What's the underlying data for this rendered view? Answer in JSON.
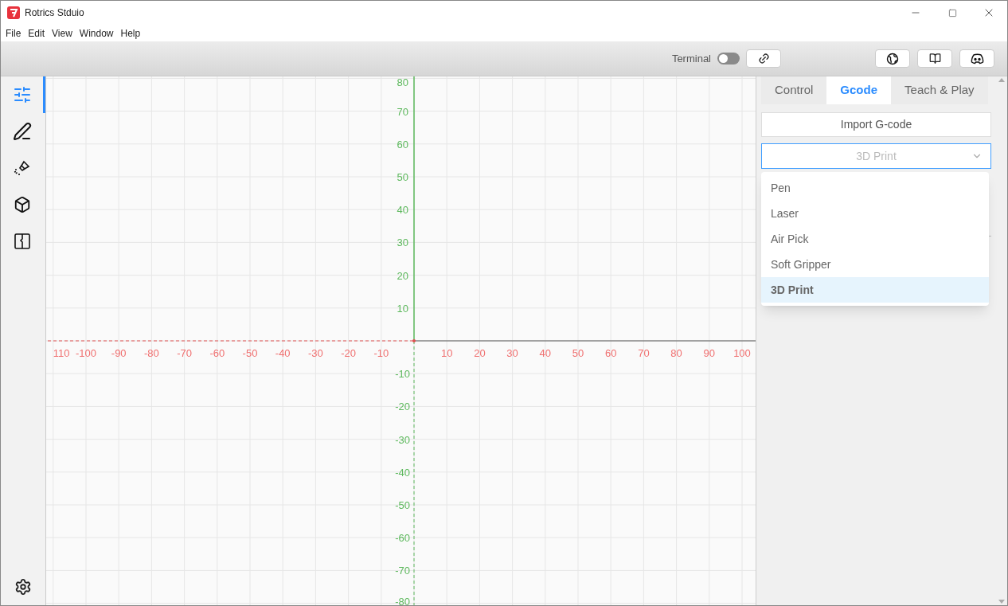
{
  "window": {
    "title": "Rotrics Stduio"
  },
  "menu": [
    "File",
    "Edit",
    "View",
    "Window",
    "Help"
  ],
  "toolbar": {
    "terminal": {
      "label": "Terminal",
      "on": false
    }
  },
  "sidebar": {
    "items": [
      {
        "kind": "sliders",
        "selected": true
      },
      {
        "kind": "pen",
        "selected": false
      },
      {
        "kind": "laser",
        "selected": false
      },
      {
        "kind": "cube",
        "selected": false
      },
      {
        "kind": "book",
        "selected": false
      }
    ]
  },
  "canvas": {
    "x_negative": [
      "110",
      "-100",
      "-90",
      "-80",
      "-70",
      "-60",
      "-50",
      "-40",
      "-30",
      "-20",
      "-10"
    ],
    "x_positive": [
      "10",
      "20",
      "30",
      "40",
      "50",
      "60",
      "70",
      "80",
      "90",
      "100"
    ],
    "y_positive": [
      "80",
      "70",
      "60",
      "50",
      "40",
      "30",
      "20",
      "10"
    ],
    "y_negative": [
      "-10",
      "-20",
      "-30",
      "-40",
      "-50",
      "-60",
      "-70",
      "-80"
    ]
  },
  "panel": {
    "tabs": [
      {
        "label": "Control",
        "selected": false
      },
      {
        "label": "Gcode",
        "selected": true
      },
      {
        "label": "Teach & Play",
        "selected": false
      }
    ],
    "import_button": "Import G-code",
    "select": {
      "value": "3D Print",
      "expanded": true,
      "options": [
        {
          "label": "Pen",
          "selected": false
        },
        {
          "label": "Laser",
          "selected": false
        },
        {
          "label": "Air Pick",
          "selected": false
        },
        {
          "label": "Soft Gripper",
          "selected": false
        },
        {
          "label": "3D Print",
          "selected": true
        }
      ]
    }
  }
}
